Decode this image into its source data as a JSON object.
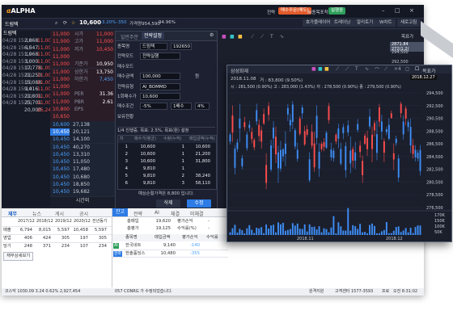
{
  "app": {
    "logo": "ALPHA",
    "logo_prefix": "α",
    "top_right_menus": [
      "전략",
      "매수주문(매도)",
      "AI종목포착",
      "실행중"
    ],
    "window_controls": [
      "–",
      "□",
      "×"
    ]
  },
  "menubar": {
    "buttons": [
      "호가플레이어",
      "트레이닝",
      "알리토기",
      "W차트",
      "새로고침"
    ]
  },
  "quote": {
    "stock_name": "드림텍",
    "price": "10,600",
    "change": "-3.20%",
    "change_value": "-350",
    "volume_info": "가격량954,590",
    "ratio": "94.96%"
  },
  "order_panel": {
    "tabs": [
      "일반주문",
      "전략설정"
    ],
    "fields": [
      {
        "label": "종목명",
        "value": "드림텍",
        "extra": "192650"
      },
      {
        "label": "전략모드",
        "value": "전략실행"
      },
      {
        "label": "매수모드",
        "value": ""
      },
      {
        "label": "매수금액",
        "value": "100,000",
        "unit": "원"
      },
      {
        "label": "전략유형",
        "value": "AI_BOMMD"
      },
      {
        "label": "1회매수가",
        "value": "10,600"
      },
      {
        "label": "매수조건",
        "value": "-5%",
        "extra": "1배수",
        "extra2": "4%"
      },
      {
        "label": "보유현황",
        "value": ""
      }
    ],
    "progress_label": "1/4 진행중, 목표: 2.5%, 목표(원) 설정",
    "table_headers": [
      "차",
      "매수가(평균)",
      "수량(누적)",
      "매입금액(누적)"
    ],
    "table_rows": [
      [
        "1",
        "10,600",
        "1",
        "10,600"
      ],
      [
        "2",
        "10,600",
        "1",
        "21,200"
      ],
      [
        "3",
        "10,600",
        "1",
        "31,800"
      ],
      [
        "4",
        "9,810",
        "1",
        "",
        ""
      ],
      [
        "5",
        "9,810",
        "2",
        "38,240"
      ],
      [
        "6",
        "9,810",
        "3",
        "58,110"
      ]
    ],
    "note": "예상손절가격은 8,800 입니다.",
    "cancel": "삭제",
    "confirm": "수정"
  },
  "left_trades": {
    "header_name": "드림텍",
    "rows": [
      [
        "04/28 15:10",
        "2,868",
        "11,000"
      ],
      [
        "04/28 15:10",
        "6,547",
        "11,000"
      ],
      [
        "04/28 15:10",
        "1,968",
        "11,000"
      ],
      [
        "04/28 15:10",
        "3,000",
        "11,000"
      ],
      [
        "04/28 15:10",
        "17,778",
        "11,000"
      ],
      [
        "04/28 15:10",
        "21,250",
        "11,000"
      ],
      [
        "04/28 15:10",
        "15,088",
        "11,000"
      ],
      [
        "04/28 15:10",
        "9,416",
        "11,000"
      ],
      [
        "04/28 15:10",
        "21,801",
        "11,000"
      ],
      [
        "04/28 15:10",
        "25,701",
        "11,000"
      ],
      [
        "",
        "20,000",
        "25,248"
      ]
    ]
  },
  "orderbook": {
    "label_col": [
      "시가",
      "고가",
      "저가",
      "",
      "기준가",
      "상한가",
      "하한가",
      "",
      "PER",
      "PBR",
      "EPS"
    ],
    "value_col": [
      "11,000",
      "11,000",
      "10,450",
      "",
      "10,950",
      "13,750",
      "7,450",
      "",
      "31.36",
      "2.61",
      ""
    ],
    "prices": [
      "11,000",
      "11,000",
      "11,000",
      "11,000",
      "11,000",
      "11,000",
      "11,000",
      "11,000",
      "11,000",
      "11,000",
      "10,800",
      "10,650",
      "10,600",
      "10,450",
      "10,450",
      "10,450",
      "10,450",
      "10,450",
      "10,450",
      "10,450",
      "10,450",
      "10,450"
    ],
    "bids": [
      "",
      "",
      "",
      "",
      "",
      "",
      "",
      "",
      "",
      "",
      "",
      "",
      "27,138",
      "20,121",
      "14,100",
      "40,270",
      "13,310",
      "11,050",
      "17,480",
      "10,680",
      "18,850",
      "19,682"
    ],
    "footer": "시간외"
  },
  "bottom_left": {
    "tabs": [
      "재무",
      "뉴스",
      "게시",
      "공시"
    ],
    "years": [
      "2017/12",
      "2018/12",
      "2019/12",
      "2020/12",
      "전년동기"
    ],
    "rows": [
      {
        "label": "매출",
        "values": [
          "6,794",
          "8,015",
          "5,597",
          "10,458",
          "5,597"
        ]
      },
      {
        "label": "영업",
        "values": [
          "406",
          "424",
          "305",
          "197",
          "305"
        ]
      },
      {
        "label": "당기",
        "values": [
          "248",
          "371",
          "234",
          "107",
          "234"
        ]
      }
    ],
    "button": "재무상세보기"
  },
  "bottom_mid": {
    "tabs": [
      "잔고",
      "전략",
      "AI",
      "체결",
      "미체결"
    ],
    "summary": [
      {
        "label": "총매입",
        "value": "19,620",
        "label2": "평가손익",
        "value2": "-"
      },
      {
        "label": "총평가",
        "value": "19,125",
        "label2": "수익률(%)",
        "value2": "-"
      }
    ],
    "headers": [
      "",
      "종목명",
      "매입금액",
      "평가손익",
      "수익률"
    ],
    "rows": [
      {
        "tag": "AI",
        "name": "한국네트",
        "amount": "9,140",
        "pl": "-140",
        "rate": ""
      },
      {
        "tag": "전략",
        "name": "한솔홀딩스",
        "amount": "10,480",
        "pl": "-355",
        "rate": ""
      }
    ]
  },
  "status_bar": {
    "left": "코스닥 1030.09 3.24 0.62%  2,927,454",
    "mid": "057 CONRG 가 수정되었습니다.",
    "right_labels": [
      "원격지원",
      "고객센터 1577-3593",
      "프로",
      "오전 8:31:02"
    ]
  },
  "chart_window": {
    "title": "삼성화재",
    "date_label": "2018.11.08",
    "price_info": "거 : 83,800 (9.50%)",
    "legend": "시 : 281,500 (0.90%)  고 : 283,000 (1.43%)  저 : 278,500 (0.90%)  종 : 279,500 (0.90%)",
    "toggle_label": "목표가",
    "date_badge": "2018.12.27",
    "x_labels": [
      "2018.11",
      "2018.12"
    ],
    "y_labels": [
      "294,500",
      "292,500",
      "290,500",
      "288,500",
      "286,500",
      "284,500",
      "282,500",
      "280,500",
      "278,500",
      "276,500"
    ],
    "vol_labels": [
      "170K",
      "150K",
      "100K",
      "50K"
    ],
    "colors": {
      "up": "#ff4d4d",
      "down": "#3e8ef7",
      "volume": "#3e8ef7"
    }
  },
  "behind_chart": {
    "toggle_label": "목표가",
    "badge": "2871.84 272(1.2)",
    "y_labels": [
      "294,500",
      "292,500"
    ]
  }
}
